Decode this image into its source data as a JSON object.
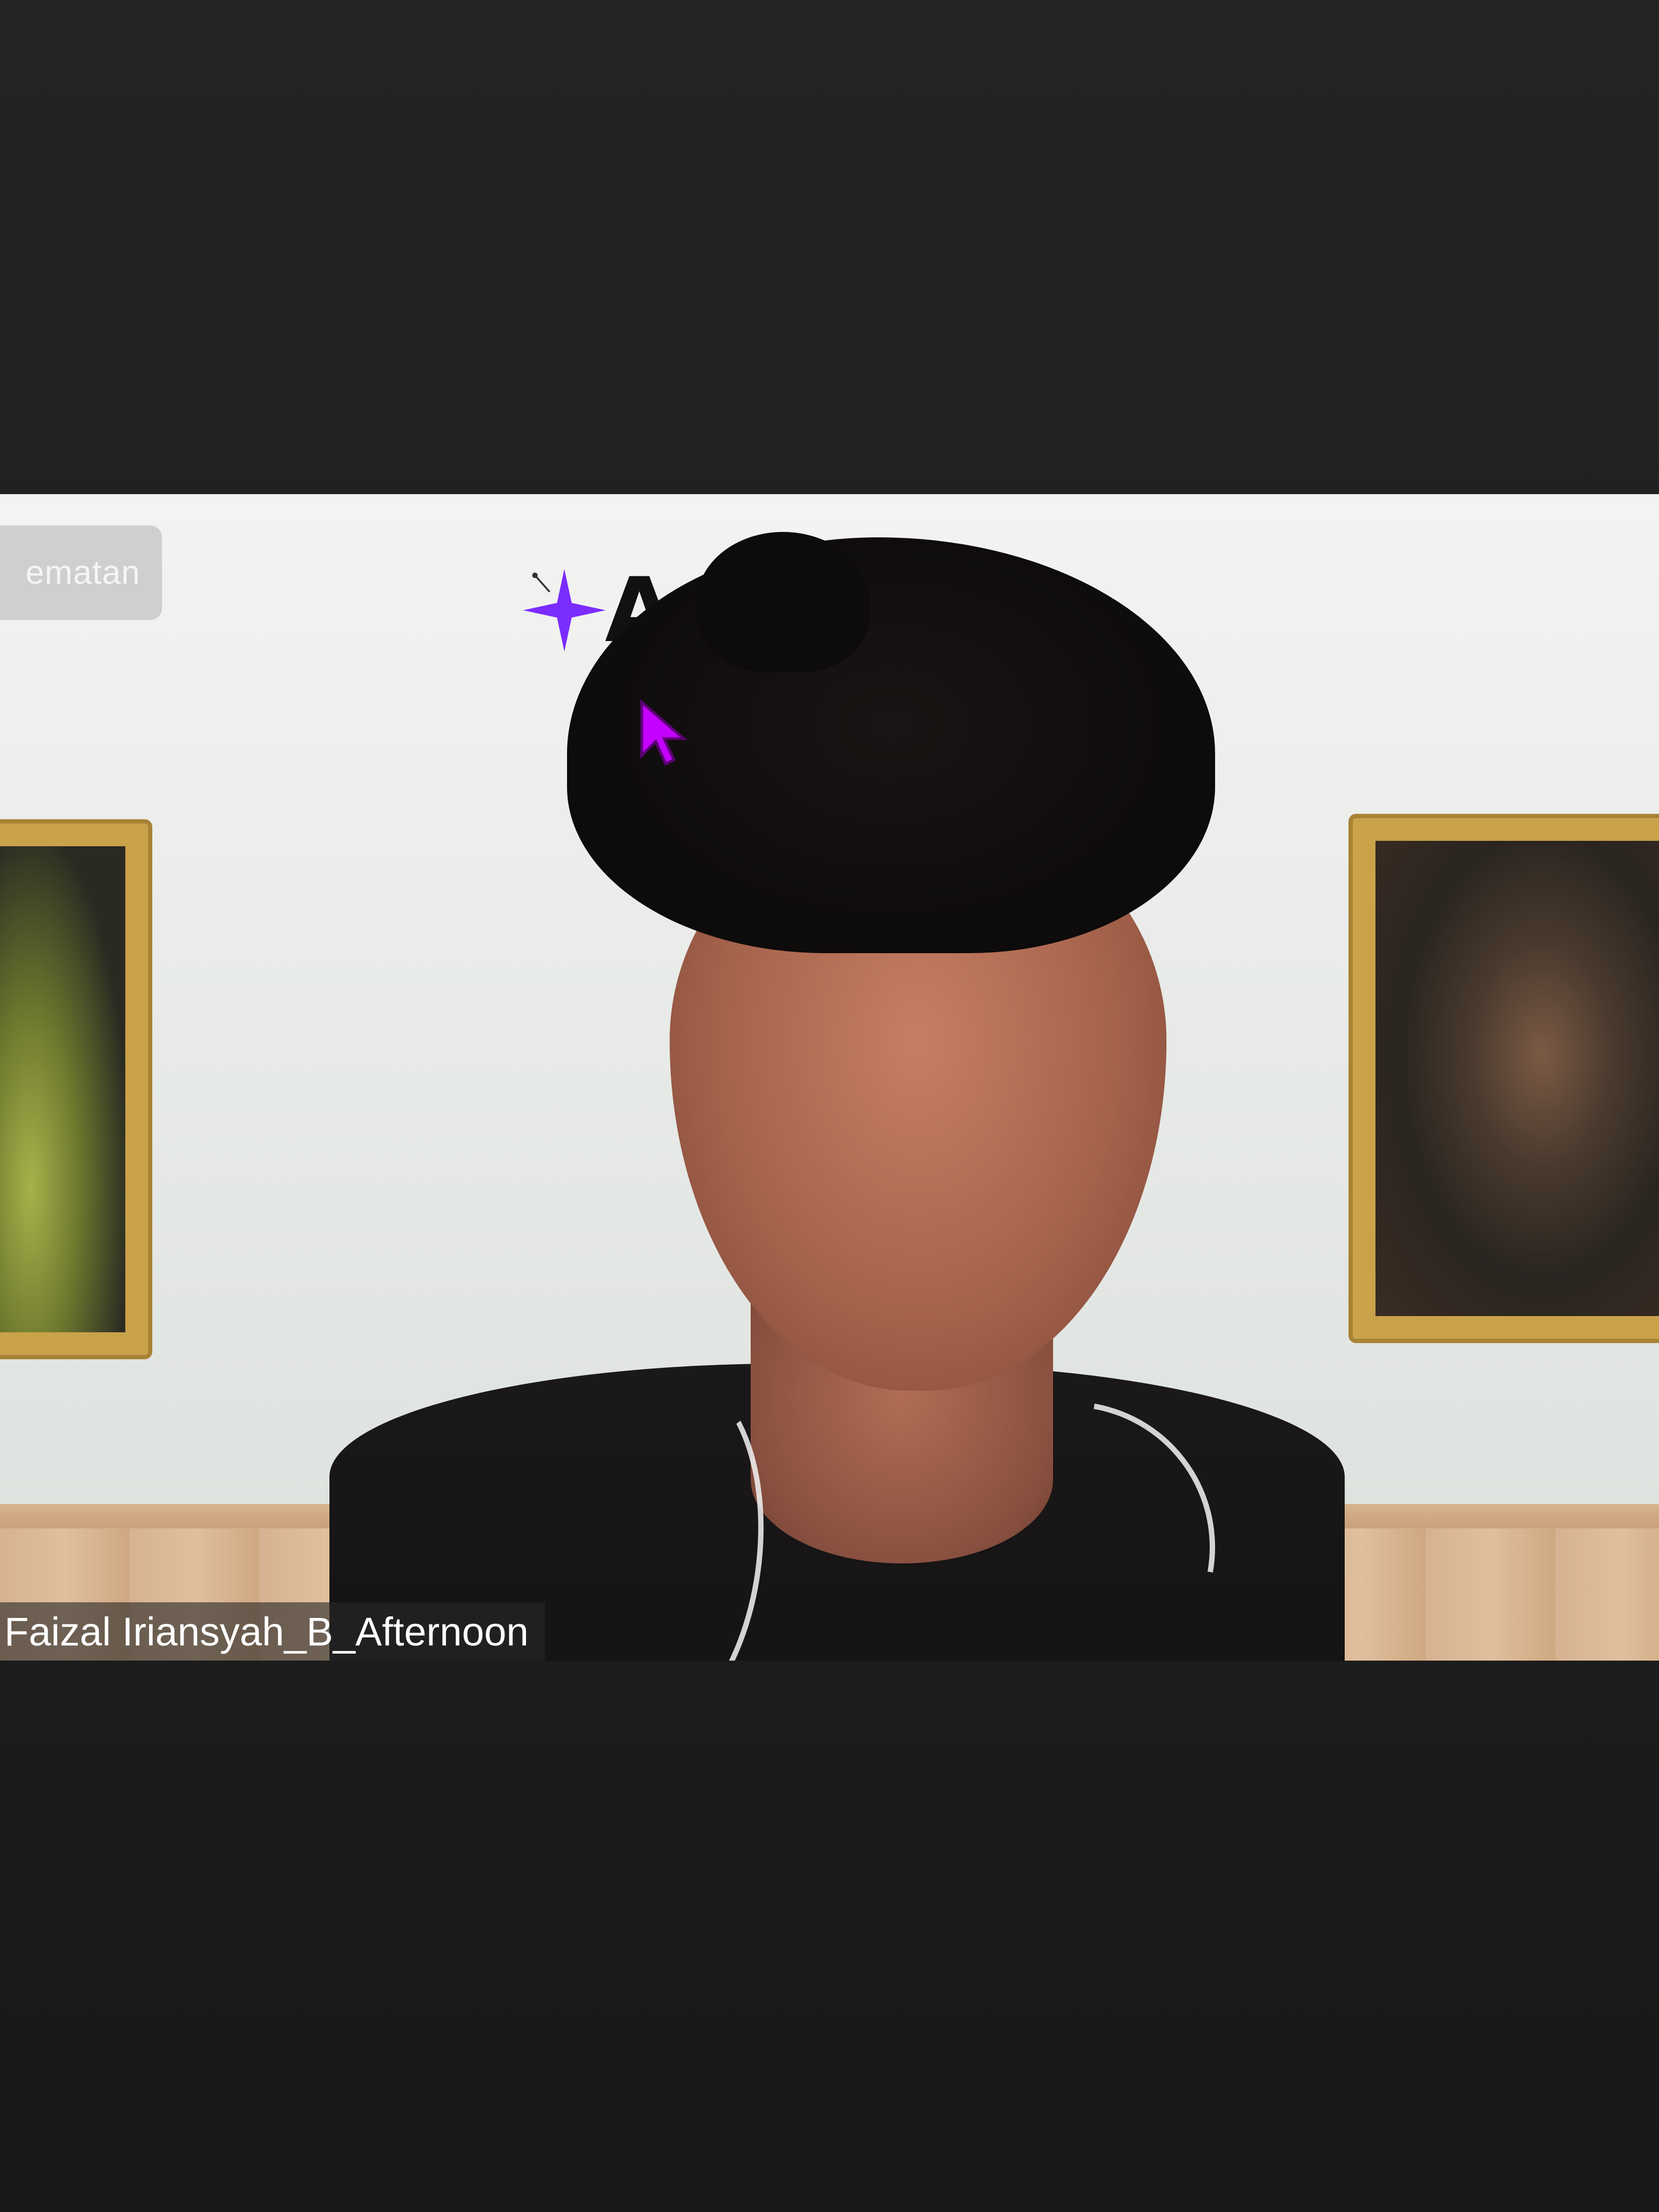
{
  "meeting": {
    "share_badge_label": "ematan",
    "slide_heading_partial": "Ar",
    "participant_name": "Faizal Iriansyah_B_Afternoon"
  },
  "icons": {
    "sparkle": "sparkle-icon",
    "cursor": "pointer-cursor-icon"
  },
  "colors": {
    "sparkle": "#7b2cff",
    "cursor": "#c400ff",
    "name_label_bg": "rgba(40,40,40,0.62)"
  }
}
